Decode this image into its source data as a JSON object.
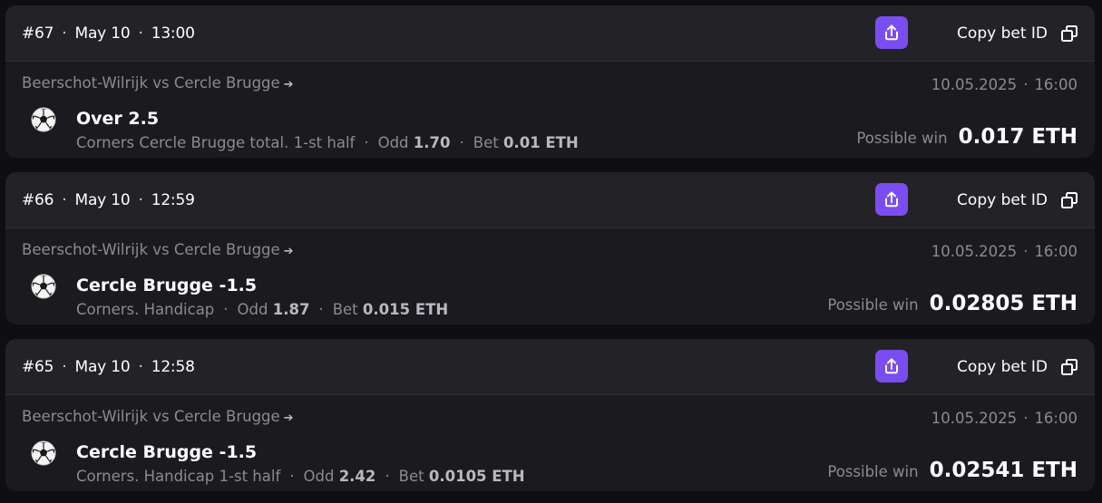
{
  "copy_label": "Copy bet ID",
  "possible_win_label": "Possible win",
  "odd_label": "Odd",
  "bet_label": "Bet",
  "colors": {
    "accent": "#7a4df0",
    "card_bg": "#1b1b1f",
    "header_bg": "#232327",
    "muted_text": "#8a8a92"
  },
  "bets": [
    {
      "id": "#67",
      "date": "May 10",
      "time": "13:00",
      "match": "Beerschot-Wilrijk vs Cercle Brugge",
      "event_date": "10.05.2025",
      "event_time": "16:00",
      "sport_icon": "soccer-ball-icon",
      "pick": "Over 2.5",
      "market": "Corners Cercle Brugge total. 1-st half",
      "odd": "1.70",
      "bet": "0.01 ETH",
      "possible_win": "0.017 ETH"
    },
    {
      "id": "#66",
      "date": "May 10",
      "time": "12:59",
      "match": "Beerschot-Wilrijk vs Cercle Brugge",
      "event_date": "10.05.2025",
      "event_time": "16:00",
      "sport_icon": "soccer-ball-icon",
      "pick": "Cercle Brugge -1.5",
      "market": "Corners. Handicap",
      "odd": "1.87",
      "bet": "0.015 ETH",
      "possible_win": "0.02805 ETH"
    },
    {
      "id": "#65",
      "date": "May 10",
      "time": "12:58",
      "match": "Beerschot-Wilrijk vs Cercle Brugge",
      "event_date": "10.05.2025",
      "event_time": "16:00",
      "sport_icon": "soccer-ball-icon",
      "pick": "Cercle Brugge -1.5",
      "market": "Corners. Handicap 1-st half",
      "odd": "2.42",
      "bet": "0.0105 ETH",
      "possible_win": "0.02541 ETH"
    }
  ]
}
